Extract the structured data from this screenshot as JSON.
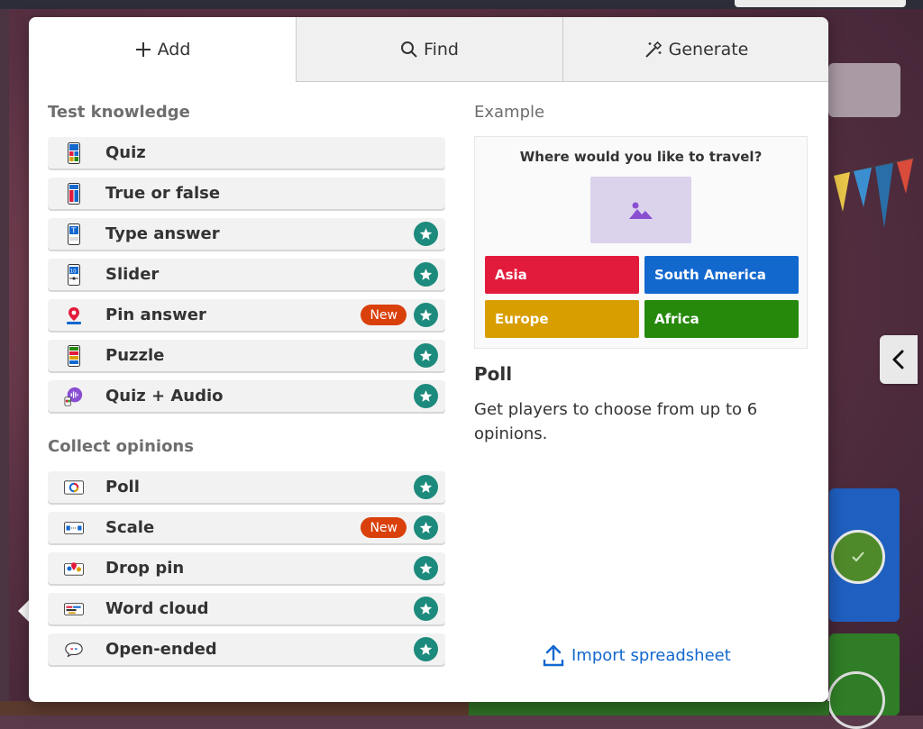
{
  "tabs": [
    {
      "label": "Add",
      "icon": "plus-icon",
      "active": true
    },
    {
      "label": "Find",
      "icon": "search-icon",
      "active": false
    },
    {
      "label": "Generate",
      "icon": "magic-wand-icon",
      "active": false
    }
  ],
  "sections": [
    {
      "title": "Test knowledge",
      "items": [
        {
          "label": "Quiz",
          "icon": "quiz-icon",
          "new": false,
          "premium": false
        },
        {
          "label": "True or false",
          "icon": "true-false-icon",
          "new": false,
          "premium": false
        },
        {
          "label": "Type answer",
          "icon": "type-answer-icon",
          "new": false,
          "premium": true
        },
        {
          "label": "Slider",
          "icon": "slider-icon",
          "new": false,
          "premium": true
        },
        {
          "label": "Pin answer",
          "icon": "pin-answer-icon",
          "new": true,
          "premium": true
        },
        {
          "label": "Puzzle",
          "icon": "puzzle-icon",
          "new": false,
          "premium": true
        },
        {
          "label": "Quiz + Audio",
          "icon": "quiz-audio-icon",
          "new": false,
          "premium": true
        }
      ]
    },
    {
      "title": "Collect opinions",
      "items": [
        {
          "label": "Poll",
          "icon": "poll-icon",
          "new": false,
          "premium": true
        },
        {
          "label": "Scale",
          "icon": "scale-icon",
          "new": true,
          "premium": true
        },
        {
          "label": "Drop pin",
          "icon": "drop-pin-icon",
          "new": false,
          "premium": true
        },
        {
          "label": "Word cloud",
          "icon": "word-cloud-icon",
          "new": false,
          "premium": true
        },
        {
          "label": "Open-ended",
          "icon": "open-ended-icon",
          "new": false,
          "premium": true
        }
      ]
    }
  ],
  "badge_new_label": "New",
  "example": {
    "label": "Example",
    "question": "Where would you like to travel?",
    "answers": [
      {
        "text": "Asia",
        "color": "#e21b3c"
      },
      {
        "text": "South America",
        "color": "#1368ce"
      },
      {
        "text": "Europe",
        "color": "#d89e00"
      },
      {
        "text": "Africa",
        "color": "#26890c"
      }
    ]
  },
  "detail": {
    "title": "Poll",
    "description": "Get players to choose from up to 6 opinions."
  },
  "import_label": "Import spreadsheet",
  "colors": {
    "accent_blue": "#1368ce",
    "premium_green": "#1c8a7c",
    "new_orange": "#d9400b"
  }
}
